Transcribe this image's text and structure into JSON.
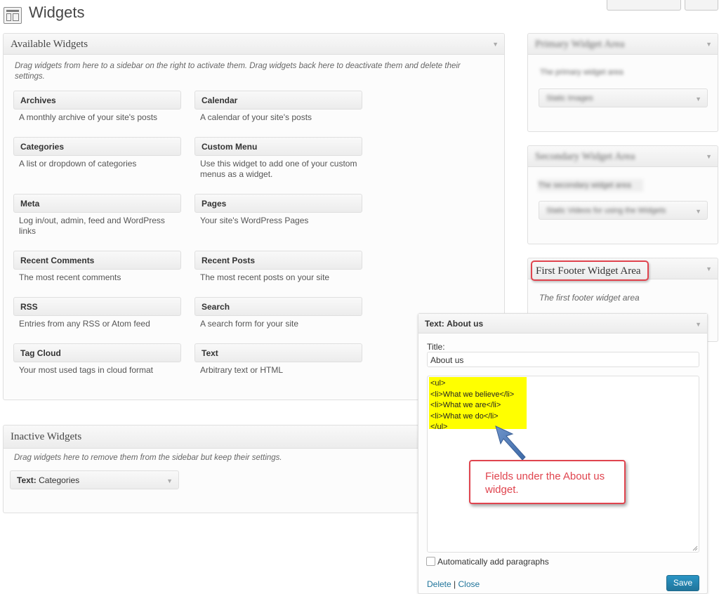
{
  "header": {
    "title": "Widgets"
  },
  "available": {
    "title": "Available Widgets",
    "description": "Drag widgets from here to a sidebar on the right to activate them. Drag widgets back here to deactivate them and delete their settings.",
    "widgets": [
      {
        "name": "Archives",
        "desc": "A monthly archive of your site's posts"
      },
      {
        "name": "Calendar",
        "desc": "A calendar of your site's posts"
      },
      {
        "name": "Categories",
        "desc": "A list or dropdown of categories"
      },
      {
        "name": "Custom Menu",
        "desc": "Use this widget to add one of your custom menus as a widget."
      },
      {
        "name": "Meta",
        "desc": "Log in/out, admin, feed and WordPress links"
      },
      {
        "name": "Pages",
        "desc": "Your site's WordPress Pages"
      },
      {
        "name": "Recent Comments",
        "desc": "The most recent comments"
      },
      {
        "name": "Recent Posts",
        "desc": "The most recent posts on your site"
      },
      {
        "name": "RSS",
        "desc": "Entries from any RSS or Atom feed"
      },
      {
        "name": "Search",
        "desc": "A search form for your site"
      },
      {
        "name": "Tag Cloud",
        "desc": "Your most used tags in cloud format"
      },
      {
        "name": "Text",
        "desc": "Arbitrary text or HTML"
      }
    ]
  },
  "inactive": {
    "title": "Inactive Widgets",
    "description": "Drag widgets here to remove them from the sidebar but keep their settings.",
    "widget_type": "Text:",
    "widget_name": "Categories"
  },
  "sidebars": {
    "primary": {
      "title": "Primary Widget Area",
      "desc": "The primary widget area",
      "item": "Static Images"
    },
    "secondary": {
      "title": "Secondary Widget Area",
      "desc": "The secondary widget area",
      "item": "Static Videos for using the Widgets"
    },
    "first_footer": {
      "title": "First Footer Widget Area",
      "desc": "The first footer widget area"
    }
  },
  "text_widget": {
    "type": "Text:",
    "name": "About us",
    "title_label": "Title:",
    "title_value": "About us",
    "content_lines": [
      "<ul>",
      "<li>What we believe</li>",
      "<li>What we are</li>",
      "<li>What we do</li>",
      "</ul>"
    ],
    "autop_label": "Automatically add paragraphs",
    "delete_label": "Delete",
    "separator": "|",
    "close_label": "Close",
    "save_label": "Save"
  },
  "callout": {
    "text": "Fields under the About us widget."
  }
}
